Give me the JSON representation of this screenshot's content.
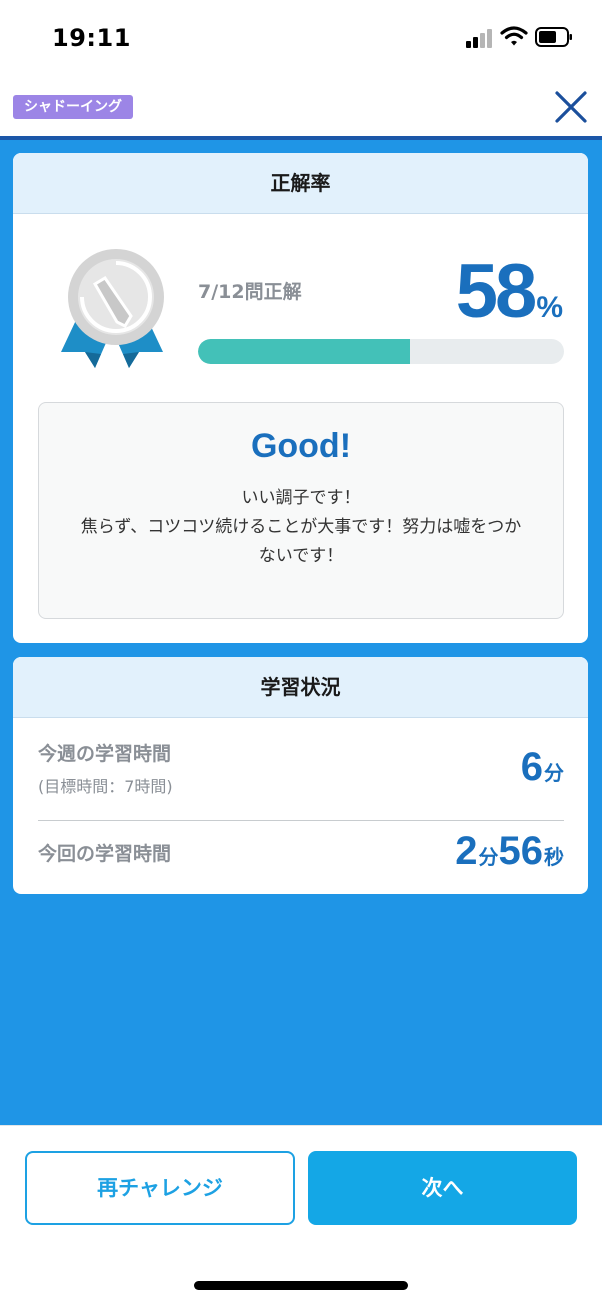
{
  "status_bar": {
    "time": "19:11"
  },
  "header": {
    "tag": "シャドーイング"
  },
  "result_card": {
    "title": "正解率",
    "score_label": "7/12問正解",
    "score_percent": "58",
    "percent_unit": "%",
    "progress_fraction": 0.58,
    "message_title": "Good!",
    "message_lines": [
      "いい調子です！",
      "焦らず、コツコツ続けることが大事です！努力は嘘をつか",
      "ないです！"
    ]
  },
  "study_card": {
    "title": "学習状況",
    "week_label": "今週の学習時間",
    "week_goal": "(目標時間：7時間)",
    "week_value": "6",
    "week_unit": "分",
    "session_label": "今回の学習時間",
    "session_min": "2",
    "session_min_unit": "分",
    "session_sec": "56",
    "session_sec_unit": "秒"
  },
  "footer": {
    "retry_label": "再チャレンジ",
    "next_label": "次へ"
  },
  "colors": {
    "accent": "#1f95e6",
    "primary_text": "#1a6fbd",
    "progress": "#43c1b8",
    "tag": "#9c85e6"
  },
  "icons": [
    "signal-icon",
    "wifi-icon",
    "battery-icon",
    "close-icon",
    "medal-icon"
  ]
}
